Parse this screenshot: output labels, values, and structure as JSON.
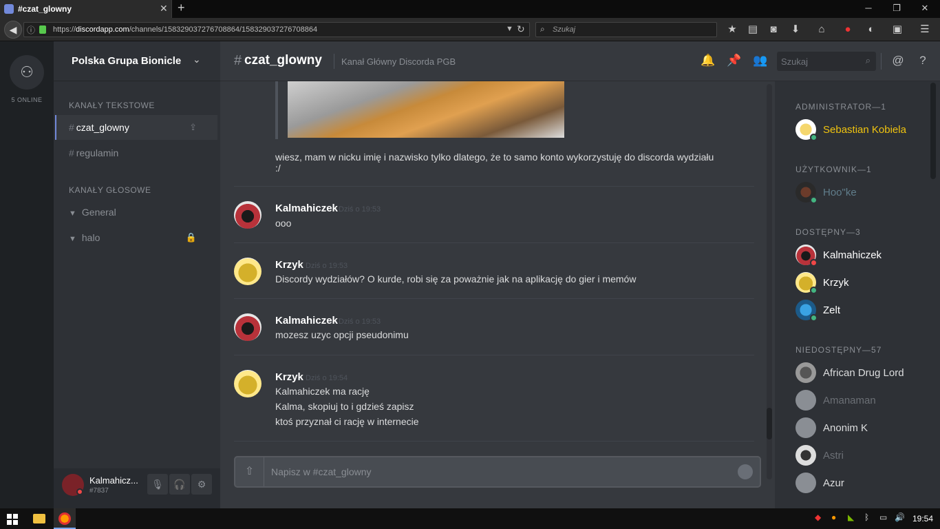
{
  "browser": {
    "tab_title": "#czat_glowny",
    "url_prefix": "https://",
    "url_host": "discordapp.com",
    "url_path": "/channels/158329037276708864/158329037276708864",
    "search_placeholder": "Szukaj"
  },
  "server": {
    "name": "Polska Grupa Bionicle",
    "online": "5 ONLINE",
    "text_category": "KANAŁY TEKSTOWE",
    "voice_category": "KANAŁY GŁOSOWE",
    "text_channels": [
      "czat_glowny",
      "regulamin"
    ],
    "voice_channels": [
      "General",
      "halo"
    ]
  },
  "user": {
    "name": "Kalmahicz...",
    "discriminator": "#7837"
  },
  "channel": {
    "name": "czat_glowny",
    "topic": "Kanał Główny Discorda PGB",
    "search_placeholder": "Szukaj"
  },
  "messages": {
    "top_text_1": "wiesz, mam w nicku imię i nazwisko tylko dlatego, że to samo konto wykorzystuję do discorda wydziału",
    "top_text_2": ":/",
    "items": [
      {
        "author": "Kalmahiczek",
        "time": "Dziś o 19:53",
        "lines": [
          "ooo"
        ]
      },
      {
        "author": "Krzyk",
        "time": "Dziś o 19:53",
        "lines": [
          "Discordy wydziałów? O kurde, robi się za poważnie jak na aplikację do gier i memów"
        ]
      },
      {
        "author": "Kalmahiczek",
        "time": "Dziś o 19:53",
        "lines": [
          "mozesz uzyc opcji pseudonimu"
        ]
      },
      {
        "author": "Krzyk",
        "time": "Dziś o 19:54",
        "lines": [
          "Kalmahiczek ma rację",
          "Kalma, skopiuj to i gdzieś zapisz",
          "ktoś przyznał ci rację w internecie"
        ]
      }
    ]
  },
  "composer": {
    "placeholder": "Napisz w #czat_glowny"
  },
  "members": {
    "groups": [
      {
        "title": "ADMINISTRATOR—1",
        "members": [
          {
            "name": "Sebastian Kobiela",
            "color": "#f1c40f",
            "status": "#43b581"
          }
        ]
      },
      {
        "title": "UŻYTKOWNIK—1",
        "members": [
          {
            "name": "Hoo\"ke",
            "color": "#607d8b",
            "status": "#43b581"
          }
        ]
      },
      {
        "title": "DOSTĘPNY—3",
        "members": [
          {
            "name": "Kalmahiczek",
            "color": "#ffffff",
            "status": "#f04747"
          },
          {
            "name": "Krzyk",
            "color": "#ffffff",
            "status": "#43b581"
          },
          {
            "name": "Zelt",
            "color": "#ffffff",
            "status": "#43b581"
          }
        ]
      },
      {
        "title": "NIEDOSTĘPNY—57",
        "members": [
          {
            "name": "African Drug Lord",
            "color": "#dcddde"
          },
          {
            "name": "Amanaman",
            "color": "#6b6f75"
          },
          {
            "name": "Anonim K",
            "color": "#dcddde"
          },
          {
            "name": "Astri",
            "color": "#6b6f75"
          },
          {
            "name": "Azur",
            "color": "#dcddde"
          }
        ]
      }
    ]
  },
  "taskbar": {
    "clock": "19:54"
  },
  "colors": {
    "accent": "#7289da",
    "online": "#43b581",
    "dnd": "#f04747",
    "admin": "#f1c40f"
  }
}
